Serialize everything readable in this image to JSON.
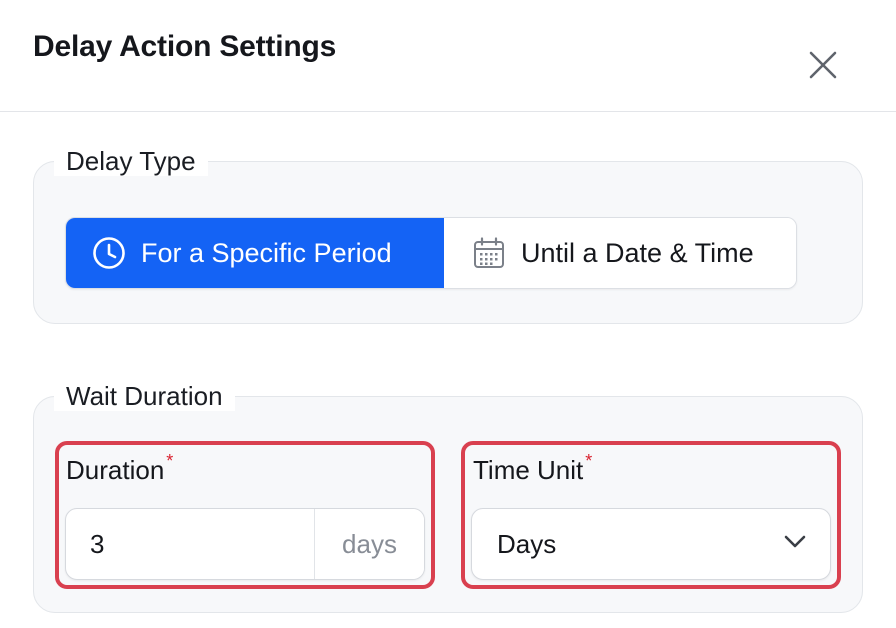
{
  "dialog": {
    "title": "Delay Action Settings",
    "close_icon": "close-icon"
  },
  "delay_type": {
    "legend": "Delay Type",
    "options": [
      {
        "label": "For a Specific Period",
        "icon": "clock-icon",
        "selected": true
      },
      {
        "label": "Until a Date & Time",
        "icon": "calendar-icon",
        "selected": false
      }
    ]
  },
  "wait_duration": {
    "legend": "Wait Duration",
    "duration": {
      "label": "Duration",
      "required_mark": "*",
      "value": "3",
      "suffix": "days"
    },
    "time_unit": {
      "label": "Time Unit",
      "required_mark": "*",
      "selected": "Days",
      "chevron_icon": "chevron-down-icon"
    }
  },
  "colors": {
    "accent": "#1463f5",
    "highlight_border": "#d9404f",
    "required": "#d9212f"
  }
}
